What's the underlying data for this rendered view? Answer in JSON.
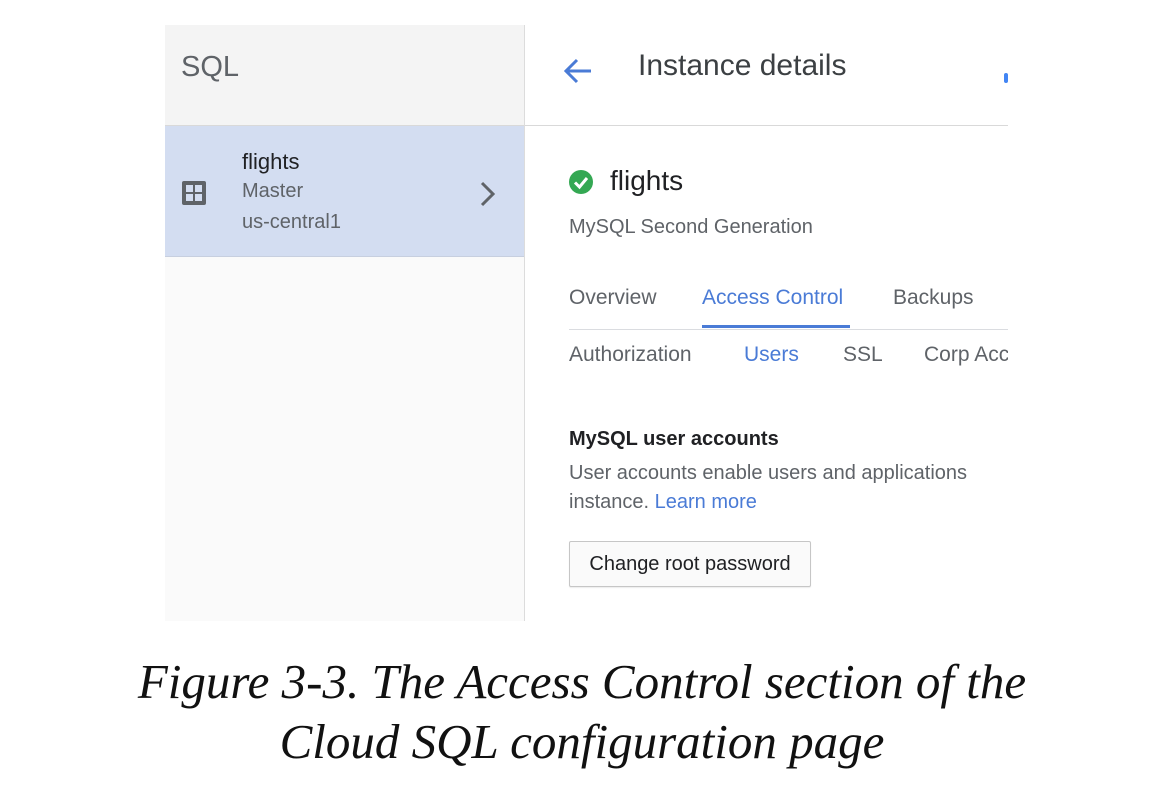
{
  "sidebar": {
    "title": "SQL",
    "instance": {
      "icon": "grid-icon",
      "name": "flights",
      "role": "Master",
      "region": "us-central1"
    }
  },
  "header": {
    "back_icon": "arrow-back-icon",
    "title": "Instance details"
  },
  "instance": {
    "status_icon": "check-circle-icon",
    "status_color": "#34a853",
    "name": "flights",
    "subtitle": "MySQL Second Generation"
  },
  "tabs": [
    {
      "label": "Overview",
      "active": false
    },
    {
      "label": "Access Control",
      "active": true
    },
    {
      "label": "Backups",
      "active": false
    }
  ],
  "subtabs": [
    {
      "label": "Authorization",
      "active": false
    },
    {
      "label": "Users",
      "active": true
    },
    {
      "label": "SSL",
      "active": false
    },
    {
      "label": "Corp Acc",
      "active": false
    }
  ],
  "section": {
    "title": "MySQL user accounts",
    "desc_line1": "User accounts enable users and applications",
    "desc_line2": "instance.",
    "learn_more": "Learn more",
    "button": "Change root password"
  },
  "caption": {
    "line1": "Figure 3-3. The Access Control section of the",
    "line2": "Cloud SQL configuration page"
  },
  "colors": {
    "accent": "#4a7bd6",
    "selected_bg": "#d3ddf1"
  }
}
